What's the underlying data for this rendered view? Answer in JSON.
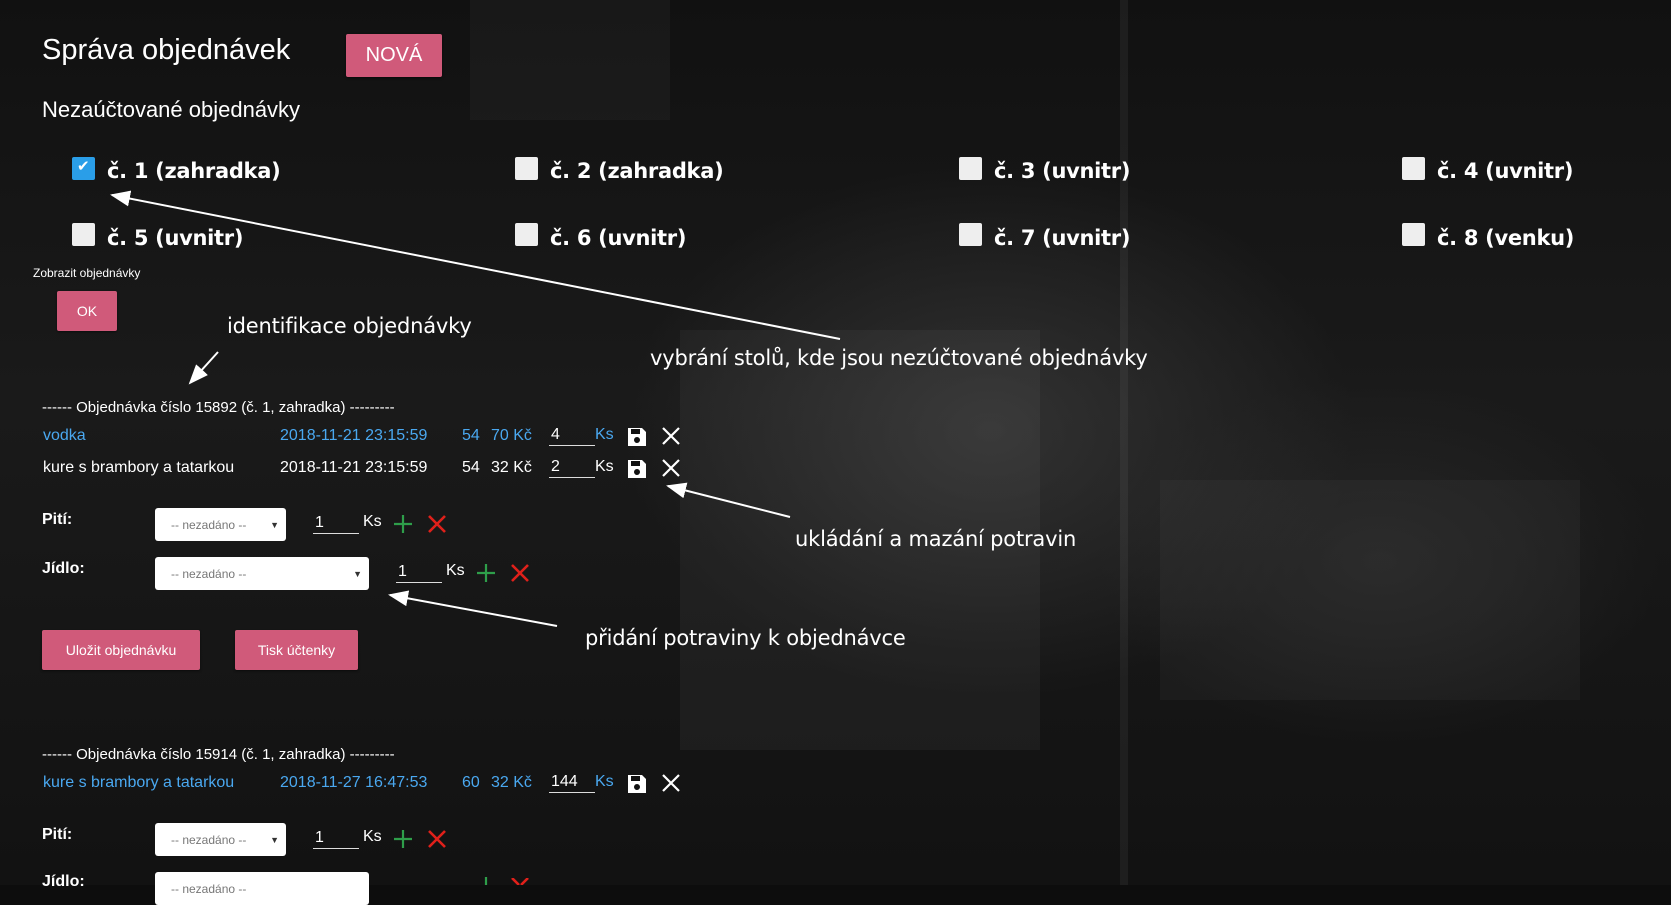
{
  "header": {
    "title": "Správa objednávek",
    "new_button": "NOVÁ"
  },
  "unbilled_heading": "Nezaúčtované objednávky",
  "tables": [
    {
      "label": "č. 1 (zahradka)",
      "checked": true
    },
    {
      "label": "č. 2 (zahradka)",
      "checked": false
    },
    {
      "label": "č. 3 (uvnitr)",
      "checked": false
    },
    {
      "label": "č. 4 (uvnitr)",
      "checked": false
    },
    {
      "label": "č. 5 (uvnitr)",
      "checked": false
    },
    {
      "label": "č. 6 (uvnitr)",
      "checked": false
    },
    {
      "label": "č. 7 (uvnitr)",
      "checked": false
    },
    {
      "label": "č. 8 (venku)",
      "checked": false
    }
  ],
  "show_orders": {
    "label": "Zobrazit objednávky",
    "ok_button": "OK"
  },
  "annotations": {
    "order_id": "identifikace objednávky",
    "table_select": "vybrání stolů, kde jsou nezúčtované objednávky",
    "save_delete": "ukládání a mazání potravin",
    "add_item": "přidání potraviny k objednávce"
  },
  "orders": [
    {
      "header": "------ Objednávka číslo 15892 (č. 1, zahradka) ---------",
      "items": [
        {
          "name": "vodka",
          "datetime": "2018-11-21 23:15:59",
          "id": "54",
          "price": "70 Kč",
          "qty": "4",
          "unit": "Ks",
          "highlight": true
        },
        {
          "name": "kure s brambory a tatarkou",
          "datetime": "2018-11-21 23:15:59",
          "id": "54",
          "price": "32 Kč",
          "qty": "2",
          "unit": "Ks",
          "highlight": false
        }
      ],
      "drink_label": "Pití:",
      "food_label": "Jídlo:",
      "select_placeholder": "-- nezadáno --",
      "add_qty": "1",
      "unit": "Ks",
      "save_button": "Uložit objednávku",
      "print_button": "Tisk účtenky"
    },
    {
      "header": "------ Objednávka číslo 15914 (č. 1, zahradka) ---------",
      "items": [
        {
          "name": "kure s brambory a tatarkou",
          "datetime": "2018-11-27 16:47:53",
          "id": "60",
          "price": "32 Kč",
          "qty": "144",
          "unit": "Ks",
          "highlight": true
        }
      ],
      "drink_label": "Pití:",
      "food_label": "Jídlo:",
      "select_placeholder": "-- nezadáno --",
      "add_qty": "1",
      "unit": "Ks"
    }
  ],
  "icons": {
    "checkbox_checked": "check-icon",
    "save": "floppy-disk-icon",
    "delete": "close-icon",
    "add": "plus-icon",
    "remove": "red-x-icon",
    "dropdown": "triangle-down-icon"
  },
  "colors": {
    "accent": "#d05a7a",
    "highlight_text": "#4aa8f0",
    "add_green": "#2e9e4a",
    "remove_red": "#e0201a",
    "checkbox_blue": "#2a9ee8"
  }
}
